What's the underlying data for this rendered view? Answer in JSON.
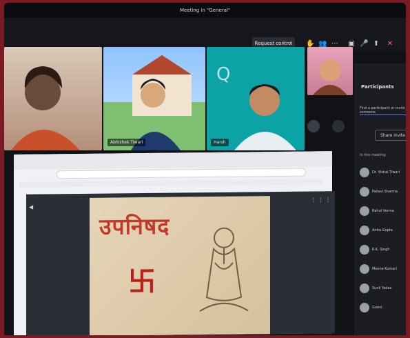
{
  "window": {
    "title": "Meeting in \"General\""
  },
  "topbar": {
    "request_control": "Request control",
    "icons": [
      "hand-icon",
      "people-icon",
      "more-icon",
      "camera-icon",
      "mic-icon",
      "share-icon",
      "leave-icon"
    ]
  },
  "participants_panel": {
    "title": "Participants",
    "search_placeholder": "Find a participant or invite someone",
    "action_label": "Share invite",
    "section": "In this meeting",
    "items": [
      {
        "name": "Dr. Vishal Tiwari"
      },
      {
        "name": "Pallavi Sharma"
      },
      {
        "name": "Rahul Verma"
      },
      {
        "name": "Anita Gupta"
      },
      {
        "name": "R.K. Singh"
      },
      {
        "name": "Meena Kumari"
      },
      {
        "name": "Sunil Yadav"
      },
      {
        "name": "Guest"
      }
    ]
  },
  "video_tiles": [
    {
      "name": ""
    },
    {
      "name": "Abhishek Tiwari"
    },
    {
      "name": "Harsh"
    },
    {
      "name": ""
    }
  ],
  "shared_screen": {
    "slide_title": "उपनिषद",
    "symbol": "卐"
  }
}
